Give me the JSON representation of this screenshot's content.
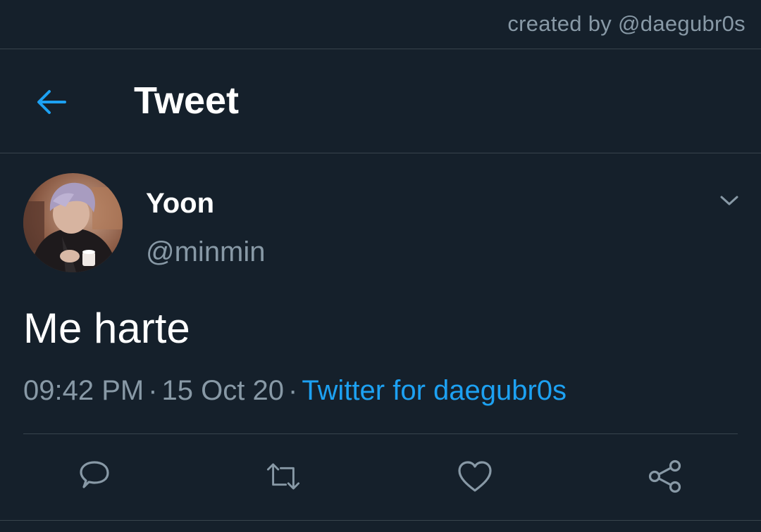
{
  "credit": "created by @daegubr0s",
  "header": {
    "title": "Tweet",
    "back_icon": "arrow-left-icon"
  },
  "tweet": {
    "author_name": "Yoon",
    "author_handle": "@minmin",
    "text": "Me harte",
    "time": "09:42 PM",
    "date": "15 Oct 20",
    "separator": "·",
    "source": "Twitter for daegubr0s"
  },
  "actions": [
    {
      "name": "reply",
      "icon": "comment-icon"
    },
    {
      "name": "retweet",
      "icon": "retweet-icon"
    },
    {
      "name": "like",
      "icon": "heart-icon"
    },
    {
      "name": "share",
      "icon": "share-icon"
    }
  ],
  "colors": {
    "background": "#15202b",
    "divider": "#38444d",
    "secondary_text": "#8899a6",
    "accent": "#1da1f2",
    "primary_text": "#ffffff"
  }
}
